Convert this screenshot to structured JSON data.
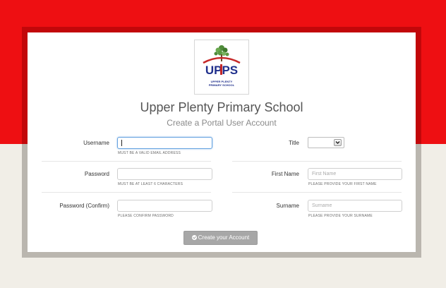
{
  "school": {
    "name": "Upper Plenty Primary School",
    "logo_wordmark": "UPPS",
    "logo_caption_line1": "UPPER PLENTY",
    "logo_caption_line2": "PRIMARY SCHOOL"
  },
  "page": {
    "subtitle": "Create a Portal User Account"
  },
  "form": {
    "username": {
      "label": "Username",
      "value": "",
      "help": "MUST BE A VALID EMAIL ADDRESS"
    },
    "password": {
      "label": "Password",
      "value": "",
      "help": "MUST BE AT LEAST 6 CHARACTERS"
    },
    "password_confirm": {
      "label": "Password (Confirm)",
      "value": "",
      "help": "PLEASE CONFIRM PASSWORD"
    },
    "title": {
      "label": "Title",
      "selected": ""
    },
    "first_name": {
      "label": "First Name",
      "placeholder": "First Name",
      "help": "PLEASE PROVIDE YOUR FIRST NAME"
    },
    "surname": {
      "label": "Surname",
      "placeholder": "Surname",
      "help": "PLEASE PROVIDE YOUR SURNAME"
    },
    "submit_label": "Create your Account"
  },
  "colors": {
    "brand_red": "#ee0f12",
    "frame_dark_red": "#c2070a",
    "page_bg": "#f1eee7",
    "button_gray": "#a7a7a7",
    "logo_blue": "#1f2f8c",
    "logo_accent_red": "#c62828"
  },
  "icons": {
    "logo": "tree-logo",
    "title_select": "chevron-down-icon",
    "submit": "check-circle-icon"
  }
}
